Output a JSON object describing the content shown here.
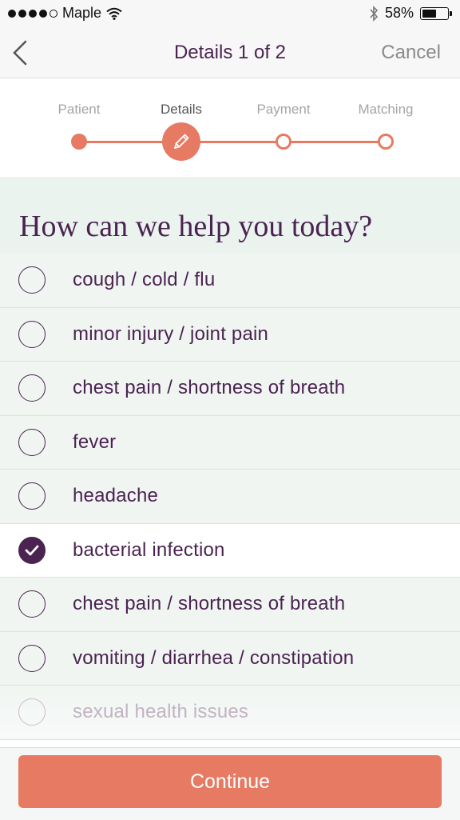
{
  "status_bar": {
    "carrier": "Maple",
    "signal_dots_filled": 4,
    "signal_dots_total": 5,
    "battery_percent_label": "58%",
    "battery_level": 0.58
  },
  "nav": {
    "title": "Details 1 of 2",
    "cancel_label": "Cancel"
  },
  "stepper": {
    "steps": [
      {
        "label": "Patient",
        "state": "done"
      },
      {
        "label": "Details",
        "state": "current"
      },
      {
        "label": "Payment",
        "state": "todo"
      },
      {
        "label": "Matching",
        "state": "todo"
      }
    ]
  },
  "question": "How can we help you today?",
  "options": [
    {
      "label": "cough / cold / flu",
      "checked": false
    },
    {
      "label": "minor injury / joint pain",
      "checked": false
    },
    {
      "label": "chest pain / shortness of breath",
      "checked": false
    },
    {
      "label": "fever",
      "checked": false
    },
    {
      "label": "headache",
      "checked": false
    },
    {
      "label": "bacterial infection",
      "checked": true
    },
    {
      "label": "chest pain / shortness of breath",
      "checked": false
    },
    {
      "label": "vomiting / diarrhea / constipation",
      "checked": false
    },
    {
      "label": "sexual health issues",
      "checked": false
    }
  ],
  "continue_label": "Continue",
  "colors": {
    "accent": "#e67a62",
    "primary_text": "#4a2350",
    "header_bg": "#ebf3ef"
  }
}
